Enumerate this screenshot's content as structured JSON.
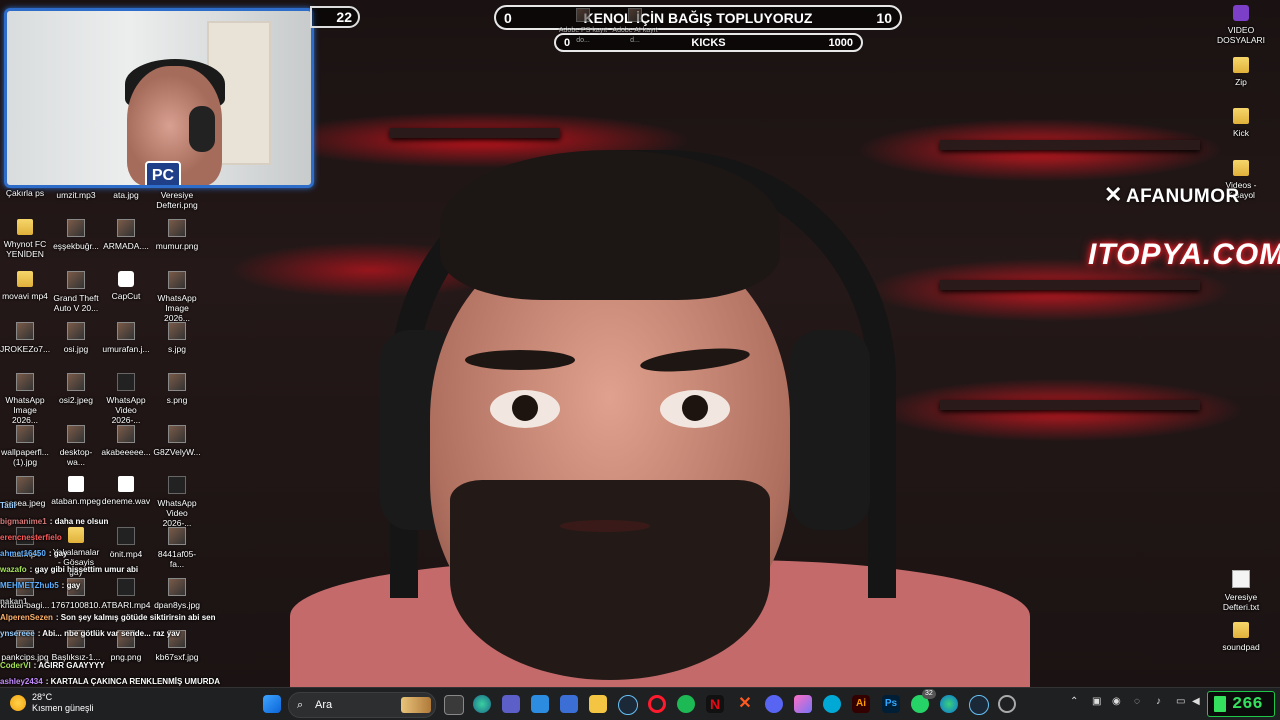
{
  "overlays": {
    "counter_left": "22",
    "goal_main": {
      "left": "0",
      "title": "KENOL İÇİN BAĞIŞ TOPLUYORUZ",
      "right": "10"
    },
    "goal_kicks": {
      "left": "0",
      "title": "KICKS",
      "right": "1000"
    },
    "afanumor": "AFANUMOR",
    "itopya": "ITOPYA.COM",
    "cam_logo": "PC"
  },
  "desktop_top_hidden": [
    {
      "label": "Adobe PS kayıt do..."
    },
    {
      "label": "Adobe AI kayıt d..."
    }
  ],
  "desktop_left": [
    {
      "label": "Çakırla ps",
      "icon": "folder"
    },
    {
      "label": "umzit.mp3",
      "icon": "vid"
    },
    {
      "label": "ata.jpg",
      "icon": "img"
    },
    {
      "label": "Veresiye Defteri.png",
      "icon": "img"
    },
    {
      "label": "Whynot FC YENİDEN",
      "icon": "folder"
    },
    {
      "label": "eşşekbuğr...",
      "icon": "img"
    },
    {
      "label": "ARMADA....",
      "icon": "img"
    },
    {
      "label": "mumur.png",
      "icon": "img"
    },
    {
      "label": "movavi mp4",
      "icon": "folder"
    },
    {
      "label": "Grand Theft Auto V 20...",
      "icon": "img"
    },
    {
      "label": "CapCut",
      "icon": "capcut"
    },
    {
      "label": "WhatsApp Image 2026...",
      "icon": "img"
    },
    {
      "label": "JROKEZo7...",
      "icon": "img"
    },
    {
      "label": "osi.jpg",
      "icon": "img"
    },
    {
      "label": "umurafan.j...",
      "icon": "img"
    },
    {
      "label": "s.jpg",
      "icon": "img"
    },
    {
      "label": "WhatsApp Image 2026...",
      "icon": "img"
    },
    {
      "label": "osi2.jpeg",
      "icon": "img"
    },
    {
      "label": "WhatsApp Video 2026-...",
      "icon": "vid"
    },
    {
      "label": "s.png",
      "icon": "img"
    },
    {
      "label": "wallpaperfl... (1).jpg",
      "icon": "img"
    },
    {
      "label": "desktop-wa...",
      "icon": "img"
    },
    {
      "label": "akabeeeee...",
      "icon": "img"
    },
    {
      "label": "G8ZVelyW...",
      "icon": "img"
    },
    {
      "label": "sssea.jpeg",
      "icon": "img"
    },
    {
      "label": "ataban.mpeg",
      "icon": "white"
    },
    {
      "label": "deneme.wav",
      "icon": "white"
    },
    {
      "label": "WhatsApp Video 2026-...",
      "icon": "vid"
    },
    {
      "label": "taa.mp4",
      "icon": "vid"
    },
    {
      "label": "Yakalamalar - Gösayis gay",
      "icon": "folder"
    },
    {
      "label": "önit.mp4",
      "icon": "vid"
    },
    {
      "label": "8441af05-fa...",
      "icon": "img"
    },
    {
      "label": "khatai-bagi...",
      "icon": "img"
    },
    {
      "label": "1767100810...",
      "icon": "img"
    },
    {
      "label": "ATBARI.mp4",
      "icon": "vid"
    },
    {
      "label": "dpan8ys.jpg",
      "icon": "img"
    },
    {
      "label": "pankcips.jpg",
      "icon": "img"
    },
    {
      "label": "Başlıksız-1...",
      "icon": "img"
    },
    {
      "label": "png.png",
      "icon": "img"
    },
    {
      "label": "kb67sxf.jpg",
      "icon": "img"
    }
  ],
  "desktop_right": [
    {
      "label": "VIDEO DOSYALARI",
      "icon": "purple"
    },
    {
      "label": "Zip",
      "icon": "folder"
    },
    {
      "label": "Kick",
      "icon": "folder"
    },
    {
      "label": "Videos - Kısayol",
      "icon": "folder"
    },
    {
      "label": "Veresiye Defteri.txt",
      "icon": "doc"
    },
    {
      "label": "soundpad",
      "icon": "folder"
    }
  ],
  "chat": [
    {
      "user": "Tatil",
      "color": "#9ad0ff",
      "text": ""
    },
    {
      "user": "bigmanime1",
      "color": "#d77a7a",
      "text": "daha ne olsun"
    },
    {
      "user": "erencnesterfielo",
      "color": "#ff5b5b",
      "text": ""
    },
    {
      "user": "ahmet16450",
      "color": "#5fb0ff",
      "text": "gay"
    },
    {
      "user": "wazafo",
      "color": "#a6e05a",
      "text": "gay gibi hissettim umur abi"
    },
    {
      "user": "MEHMETZhub5",
      "color": "#5fb0ff",
      "text": "gay"
    },
    {
      "user": "nakan1",
      "color": "#bbbbbb",
      "text": ""
    },
    {
      "user": "AlperenSezen",
      "color": "#ffb36b",
      "text": "Son şey kalmış götüde siktirirsin abi sen"
    },
    {
      "user": "ynsereee",
      "color": "#9ad0ff",
      "text": "Abi... nbe götlük var sende... raz yav"
    },
    {
      "user": "",
      "color": "#fff",
      "text": ""
    },
    {
      "user": "CoderVI",
      "color": "#a6e05a",
      "text": "AĞIRR GAAYYYY"
    },
    {
      "user": "ashley2434",
      "color": "#c58cff",
      "text": "KARTALA ÇAKINCA RENKLENMİŞ UMURDA"
    }
  ],
  "taskbar": {
    "weather_temp": "28°C",
    "weather_text": "Kısmen güneşli",
    "search_placeholder": "Ara",
    "whatsapp_badge": "32",
    "kick_count": "266"
  },
  "colors": {
    "accent": "#2d6cc8",
    "kick_green": "#35e05e",
    "itopya_glow": "#e2202a"
  }
}
